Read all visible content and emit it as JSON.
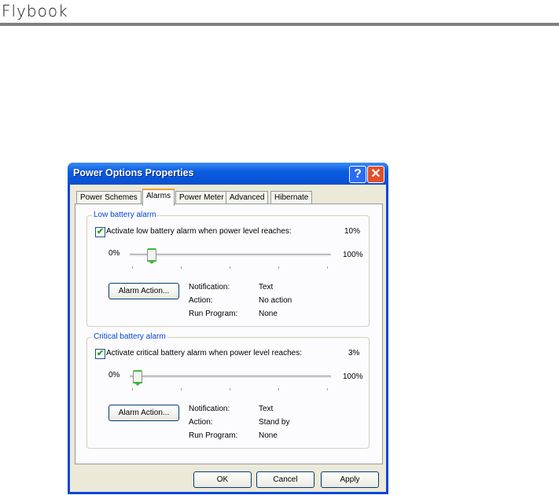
{
  "brand": "Flybook",
  "window": {
    "title": "Power Options Properties",
    "help_label": "?",
    "close_label": "✕"
  },
  "tabs": [
    "Power Schemes",
    "Alarms",
    "Power Meter",
    "Advanced",
    "Hibernate"
  ],
  "active_tab": "Alarms",
  "low": {
    "legend": "Low battery alarm",
    "checkbox_label": "Activate low battery alarm when power level reaches:",
    "checked": true,
    "value_label": "10%",
    "value_percent": 10,
    "min_label": "0%",
    "max_label": "100%",
    "button": "Alarm Action...",
    "notification_label": "Notification:",
    "notification": "Text",
    "action_label": "Action:",
    "action": "No action",
    "program_label": "Run Program:",
    "program": "None"
  },
  "critical": {
    "legend": "Critical battery alarm",
    "checkbox_label": "Activate critical battery alarm when power level reaches:",
    "checked": true,
    "value_label": "3%",
    "value_percent": 3,
    "min_label": "0%",
    "max_label": "100%",
    "button": "Alarm Action...",
    "notification_label": "Notification:",
    "notification": "Text",
    "action_label": "Action:",
    "action": "Stand by",
    "program_label": "Run Program:",
    "program": "None"
  },
  "buttons": {
    "ok": "OK",
    "cancel": "Cancel",
    "apply": "Apply"
  }
}
